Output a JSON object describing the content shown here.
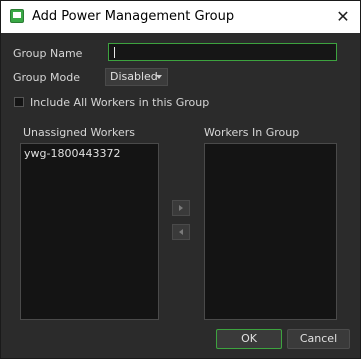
{
  "window": {
    "title": "Add Power Management Group",
    "close_glyph": "✕"
  },
  "form": {
    "group_name_label": "Group Name",
    "group_name_value": "",
    "group_mode_label": "Group Mode",
    "group_mode_value": "Disabled",
    "include_all_label": "Include All Workers in this Group",
    "include_all_checked": false
  },
  "lists": {
    "unassigned_label": "Unassigned Workers",
    "unassigned_items": [
      "ywg-1800443372"
    ],
    "in_group_label": "Workers In Group",
    "in_group_items": []
  },
  "buttons": {
    "ok_label": "OK",
    "cancel_label": "Cancel"
  },
  "colors": {
    "accent": "#3da33f",
    "background": "#2b2b2b",
    "titlebar": "#ffffff"
  }
}
